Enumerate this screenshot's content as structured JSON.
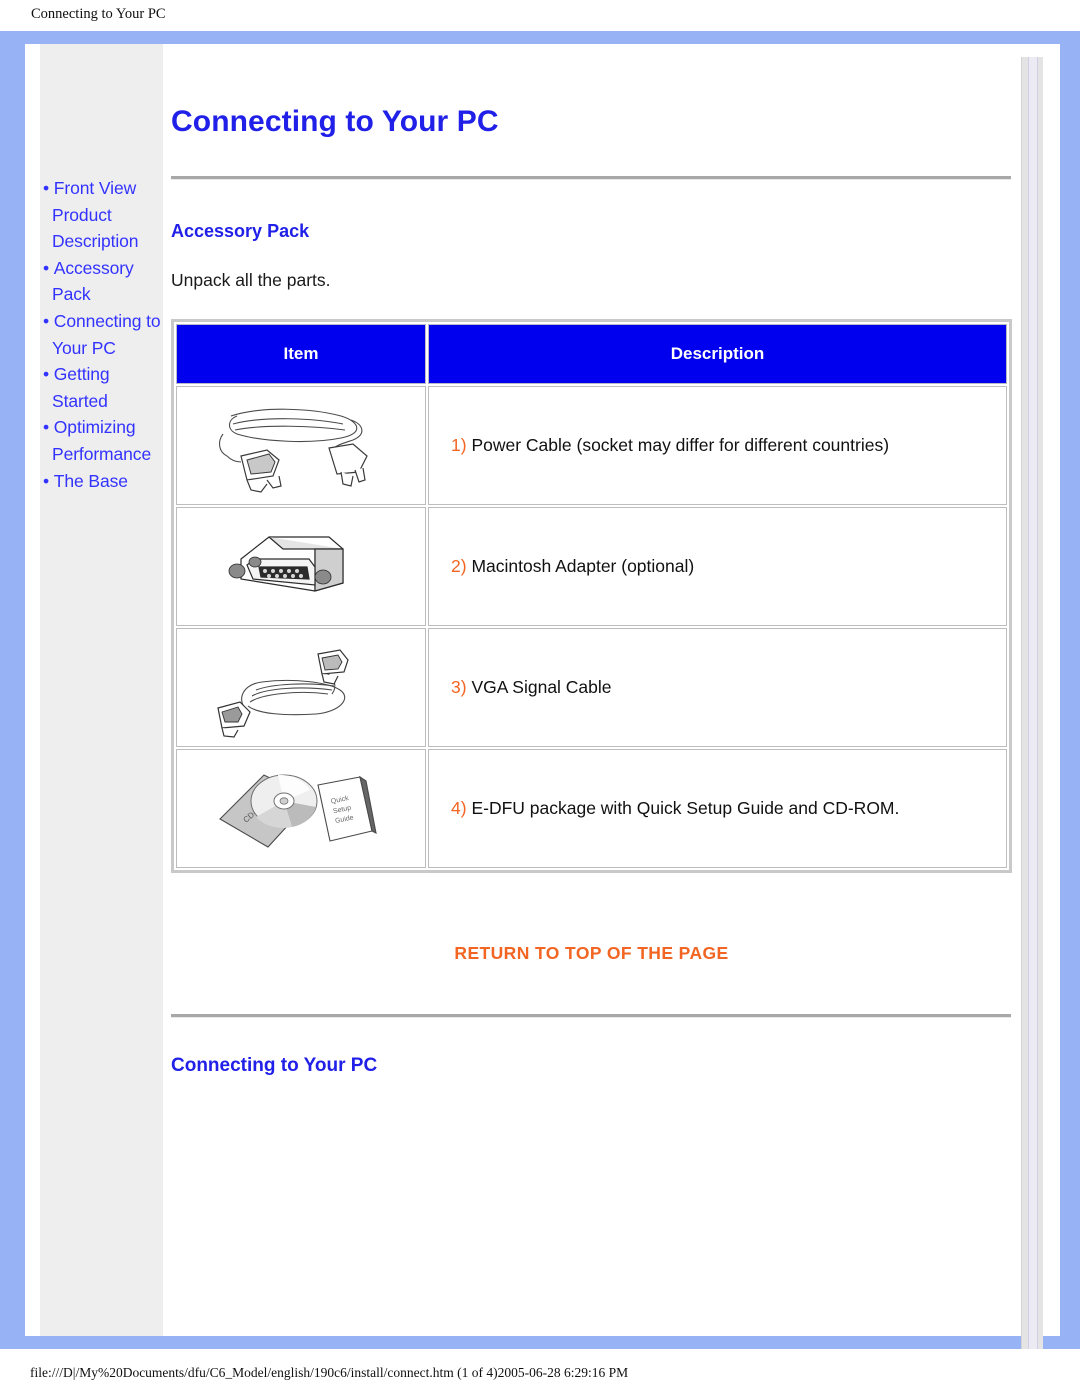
{
  "browser": {
    "print_header": "Connecting to Your PC",
    "print_footer": "file:///D|/My%20Documents/dfu/C6_Model/english/190c6/install/connect.htm (1 of 4)2005-06-28 6:29:16 PM"
  },
  "sidebar": {
    "items": [
      {
        "label": "Front View Product Description"
      },
      {
        "label": "Accessory Pack"
      },
      {
        "label": "Connecting to Your PC"
      },
      {
        "label": "Getting Started"
      },
      {
        "label": "Optimizing Performance"
      },
      {
        "label": "The Base"
      }
    ]
  },
  "main": {
    "page_title": "Connecting to Your PC",
    "accessory_section": {
      "heading": "Accessory Pack",
      "intro": "Unpack all the parts.",
      "table": {
        "headers": [
          "Item",
          "Description"
        ],
        "rows": [
          {
            "icon": "power-cable-icon",
            "number": "1)",
            "description": "Power Cable (socket may differ for different countries)"
          },
          {
            "icon": "macintosh-adapter-icon",
            "number": "2)",
            "description": "Macintosh Adapter (optional)"
          },
          {
            "icon": "vga-signal-cable-icon",
            "number": "3)",
            "description": "VGA Signal Cable"
          },
          {
            "icon": "cdrom-package-icon",
            "number": "4)",
            "description": "E-DFU package with Quick Setup Guide and CD-ROM."
          }
        ]
      },
      "return_to_top": "RETURN TO TOP OF THE PAGE"
    },
    "connecting_section": {
      "heading": "Connecting to Your PC"
    }
  },
  "colors": {
    "frame_blue": "#98b3f5",
    "heading_blue": "#2020e8",
    "table_header_blue": "#0000ee",
    "accent_orange": "#f26522",
    "sidebar_gray": "#eeeeee"
  },
  "icon_labels": {
    "cdrom_sleeve": "CD-ROM",
    "booklet_line1": "Quick",
    "booklet_line2": "Setup",
    "booklet_line3": "Guide"
  }
}
